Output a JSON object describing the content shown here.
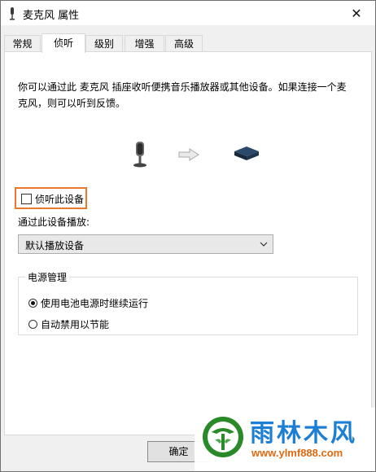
{
  "window": {
    "title": "麦克风 属性",
    "close_symbol": "✕"
  },
  "tabs": [
    {
      "label": "常规",
      "active": false
    },
    {
      "label": "侦听",
      "active": true
    },
    {
      "label": "级别",
      "active": false
    },
    {
      "label": "增强",
      "active": false
    },
    {
      "label": "高级",
      "active": false
    }
  ],
  "listen_tab": {
    "description": "你可以通过此 麦克风 插座收听便携音乐播放器或其他设备。如果连接一个麦克风，则可以听到反馈。",
    "flow_icons": [
      "microphone-icon",
      "arrow-right-icon",
      "speaker-icon"
    ],
    "listen_checkbox": {
      "label": "侦听此设备",
      "checked": false,
      "highlight_color": "#e8792c"
    },
    "playback_label": "通过此设备播放:",
    "playback_dropdown": {
      "selected": "默认播放设备"
    },
    "power": {
      "legend": "电源管理",
      "options": [
        {
          "label": "使用电池电源时继续运行",
          "checked": true
        },
        {
          "label": "自动禁用以节能",
          "checked": false
        }
      ]
    }
  },
  "buttons": {
    "ok": "确定"
  },
  "watermark": {
    "title": "雨林木风",
    "url": "www.ylmf888.com",
    "colors": {
      "title": "#1d7fd4",
      "url": "#e06a12"
    }
  }
}
